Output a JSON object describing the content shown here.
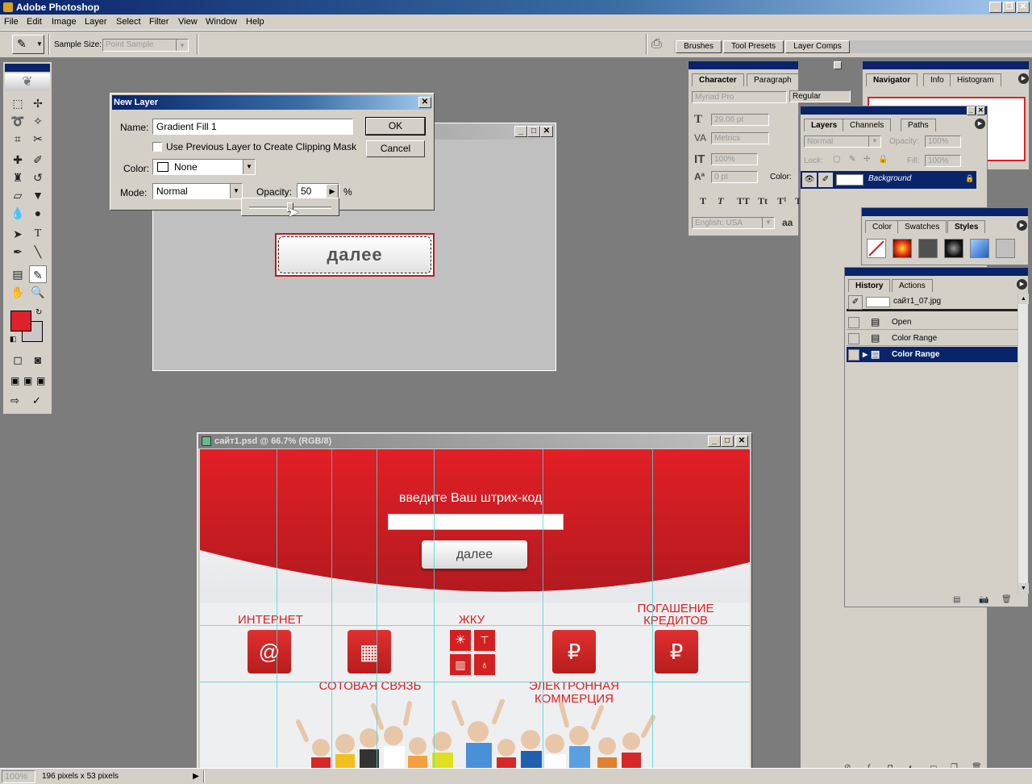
{
  "app": {
    "title": "Adobe Photoshop",
    "menu": [
      "File",
      "Edit",
      "Image",
      "Layer",
      "Select",
      "Filter",
      "View",
      "Window",
      "Help"
    ]
  },
  "options_bar": {
    "sample_size_label": "Sample Size:",
    "sample_size_value": "Point Sample",
    "well_tabs": [
      "Brushes",
      "Tool Presets",
      "Layer Comps"
    ]
  },
  "dialog": {
    "title": "New Layer",
    "name_label": "Name:",
    "name_value": "Gradient Fill 1",
    "clip_label": "Use Previous Layer to Create Clipping Mask",
    "color_label": "Color:",
    "color_value": "None",
    "mode_label": "Mode:",
    "mode_value": "Normal",
    "opacity_label": "Opacity:",
    "opacity_value": "50",
    "opacity_unit": "%",
    "opacity_slider_fraction": 0.5,
    "ok": "OK",
    "cancel": "Cancel"
  },
  "preview_window": {
    "button_text": "далее"
  },
  "character_panel": {
    "tabs": [
      "Character",
      "Paragraph"
    ],
    "font": "Myriad Pro",
    "style": "Regular",
    "size": "29.06 pt",
    "tracking": "Metrics",
    "vscale": "100%",
    "baseline": "0 pt",
    "color_label": "Color:",
    "language": "English: USA",
    "aa": "aa",
    "style_buttons": [
      "T",
      "T",
      "TT",
      "Tt",
      "T¹",
      "T"
    ]
  },
  "navigator_panel": {
    "tabs": [
      "Navigator",
      "Info",
      "Histogram"
    ]
  },
  "layers_panel": {
    "tabs": [
      "Layers",
      "Channels",
      "Paths"
    ],
    "blend": "Normal",
    "opacity_label": "Opacity:",
    "opacity_value": "100%",
    "lock_label": "Lock:",
    "fill_label": "Fill:",
    "fill_value": "100%",
    "layer_name": "Background"
  },
  "styles_panel": {
    "tabs": [
      "Color",
      "Swatches",
      "Styles"
    ]
  },
  "history_panel": {
    "tabs": [
      "History",
      "Actions"
    ],
    "snapshot": "сайт1_07.jpg",
    "items": [
      "Open",
      "Color Range",
      "Color Range"
    ]
  },
  "document": {
    "title": "сайт1.psd @ 66.7% (RGB/8)",
    "prompt": "введите Ваш штрих-код",
    "button": "далее",
    "services": {
      "internet": "ИНТЕРНЕТ",
      "mobile": "СОТОВАЯ СВЯЗЬ",
      "utilities": "ЖКУ",
      "ecommerce_1": "ЭЛЕКТРОННАЯ",
      "ecommerce_2": "КОММЕРЦИЯ",
      "credit_1": "ПОГАШЕНИЕ",
      "credit_2": "КРЕДИТОВ"
    },
    "icons": {
      "internet": "@",
      "mobile": "▦",
      "ecommerce": "₽",
      "credit": "₽"
    }
  },
  "status": {
    "zoom": "100%",
    "info": "196 pixels x 53 pixels"
  },
  "colors": {
    "foreground": "#e0202a",
    "background": "#c8c8c8",
    "brand_red": "#dc2020",
    "title_blue": "#0a246a"
  }
}
